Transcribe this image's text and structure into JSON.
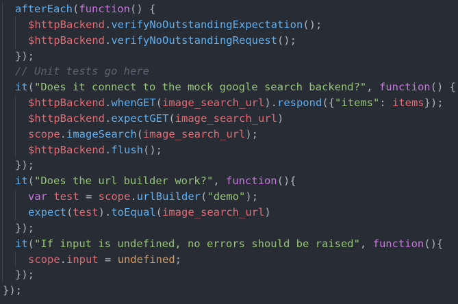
{
  "lines": [
    {
      "indent": 1,
      "tokens": [
        {
          "t": "afterEach",
          "c": "fn"
        },
        {
          "t": "(",
          "c": "plain"
        },
        {
          "t": "function",
          "c": "kw"
        },
        {
          "t": "() {",
          "c": "plain"
        }
      ]
    },
    {
      "indent": 2,
      "tokens": [
        {
          "t": "$httpBackend",
          "c": "var"
        },
        {
          "t": ".",
          "c": "plain"
        },
        {
          "t": "verifyNoOutstandingExpectation",
          "c": "fn"
        },
        {
          "t": "();",
          "c": "plain"
        }
      ]
    },
    {
      "indent": 2,
      "tokens": [
        {
          "t": "$httpBackend",
          "c": "var"
        },
        {
          "t": ".",
          "c": "plain"
        },
        {
          "t": "verifyNoOutstandingRequest",
          "c": "fn"
        },
        {
          "t": "();",
          "c": "plain"
        }
      ]
    },
    {
      "indent": 1,
      "tokens": [
        {
          "t": "});",
          "c": "plain"
        }
      ]
    },
    {
      "indent": 1,
      "tokens": [
        {
          "t": "// Unit tests go here",
          "c": "cmt"
        }
      ]
    },
    {
      "indent": 1,
      "tokens": [
        {
          "t": "it",
          "c": "fn"
        },
        {
          "t": "(",
          "c": "plain"
        },
        {
          "t": "\"Does it connect to the mock google search backend?\"",
          "c": "str"
        },
        {
          "t": ", ",
          "c": "plain"
        },
        {
          "t": "function",
          "c": "kw"
        },
        {
          "t": "() {",
          "c": "plain"
        }
      ]
    },
    {
      "indent": 2,
      "tokens": [
        {
          "t": "$httpBackend",
          "c": "var"
        },
        {
          "t": ".",
          "c": "plain"
        },
        {
          "t": "whenGET",
          "c": "fn"
        },
        {
          "t": "(",
          "c": "plain"
        },
        {
          "t": "image_search_url",
          "c": "var"
        },
        {
          "t": ").",
          "c": "plain"
        },
        {
          "t": "respond",
          "c": "fn"
        },
        {
          "t": "({",
          "c": "plain"
        },
        {
          "t": "\"items\"",
          "c": "str"
        },
        {
          "t": ": ",
          "c": "plain"
        },
        {
          "t": "items",
          "c": "var"
        },
        {
          "t": "});",
          "c": "plain"
        }
      ]
    },
    {
      "indent": 2,
      "tokens": [
        {
          "t": "$httpBackend",
          "c": "var"
        },
        {
          "t": ".",
          "c": "plain"
        },
        {
          "t": "expectGET",
          "c": "fn"
        },
        {
          "t": "(",
          "c": "plain"
        },
        {
          "t": "image_search_url",
          "c": "var"
        },
        {
          "t": ")",
          "c": "plain"
        }
      ]
    },
    {
      "indent": 2,
      "tokens": [
        {
          "t": "scope",
          "c": "var"
        },
        {
          "t": ".",
          "c": "plain"
        },
        {
          "t": "imageSearch",
          "c": "fn"
        },
        {
          "t": "(",
          "c": "plain"
        },
        {
          "t": "image_search_url",
          "c": "var"
        },
        {
          "t": ");",
          "c": "plain"
        }
      ]
    },
    {
      "indent": 2,
      "tokens": [
        {
          "t": "$httpBackend",
          "c": "var"
        },
        {
          "t": ".",
          "c": "plain"
        },
        {
          "t": "flush",
          "c": "fn"
        },
        {
          "t": "();",
          "c": "plain"
        }
      ]
    },
    {
      "indent": 1,
      "tokens": [
        {
          "t": "});",
          "c": "plain"
        }
      ]
    },
    {
      "indent": 1,
      "tokens": [
        {
          "t": "it",
          "c": "fn"
        },
        {
          "t": "(",
          "c": "plain"
        },
        {
          "t": "\"Does the url builder work?\"",
          "c": "str"
        },
        {
          "t": ", ",
          "c": "plain"
        },
        {
          "t": "function",
          "c": "kw"
        },
        {
          "t": "(){",
          "c": "plain"
        }
      ]
    },
    {
      "indent": 2,
      "tokens": [
        {
          "t": "var",
          "c": "kw"
        },
        {
          "t": " ",
          "c": "plain"
        },
        {
          "t": "test",
          "c": "var"
        },
        {
          "t": " = ",
          "c": "plain"
        },
        {
          "t": "scope",
          "c": "var"
        },
        {
          "t": ".",
          "c": "plain"
        },
        {
          "t": "urlBuilder",
          "c": "fn"
        },
        {
          "t": "(",
          "c": "plain"
        },
        {
          "t": "\"demo\"",
          "c": "str"
        },
        {
          "t": ");",
          "c": "plain"
        }
      ]
    },
    {
      "indent": 2,
      "tokens": [
        {
          "t": "expect",
          "c": "fn"
        },
        {
          "t": "(",
          "c": "plain"
        },
        {
          "t": "test",
          "c": "var"
        },
        {
          "t": ").",
          "c": "plain"
        },
        {
          "t": "toEqual",
          "c": "fn"
        },
        {
          "t": "(",
          "c": "plain"
        },
        {
          "t": "image_search_url",
          "c": "var"
        },
        {
          "t": ")",
          "c": "plain"
        }
      ]
    },
    {
      "indent": 1,
      "tokens": [
        {
          "t": "});",
          "c": "plain"
        }
      ]
    },
    {
      "indent": 1,
      "tokens": [
        {
          "t": "it",
          "c": "fn"
        },
        {
          "t": "(",
          "c": "plain"
        },
        {
          "t": "\"If input is undefined, no errors should be raised\"",
          "c": "str"
        },
        {
          "t": ", ",
          "c": "plain"
        },
        {
          "t": "function",
          "c": "kw"
        },
        {
          "t": "(){",
          "c": "plain"
        }
      ]
    },
    {
      "indent": 2,
      "tokens": [
        {
          "t": "scope",
          "c": "var"
        },
        {
          "t": ".",
          "c": "plain"
        },
        {
          "t": "input",
          "c": "var"
        },
        {
          "t": " = ",
          "c": "plain"
        },
        {
          "t": "undefined",
          "c": "num"
        },
        {
          "t": ";",
          "c": "plain"
        }
      ]
    },
    {
      "indent": 1,
      "tokens": [
        {
          "t": "});",
          "c": "plain"
        }
      ]
    },
    {
      "indent": 0,
      "tokens": [
        {
          "t": "});",
          "c": "plain"
        }
      ]
    }
  ],
  "theme": {
    "background": "#282c34",
    "plain": "#abb2bf",
    "function": "#61afef",
    "keyword": "#c678dd",
    "string": "#98c379",
    "variable": "#e06c75",
    "comment": "#5c6370",
    "constant": "#d19a66"
  }
}
